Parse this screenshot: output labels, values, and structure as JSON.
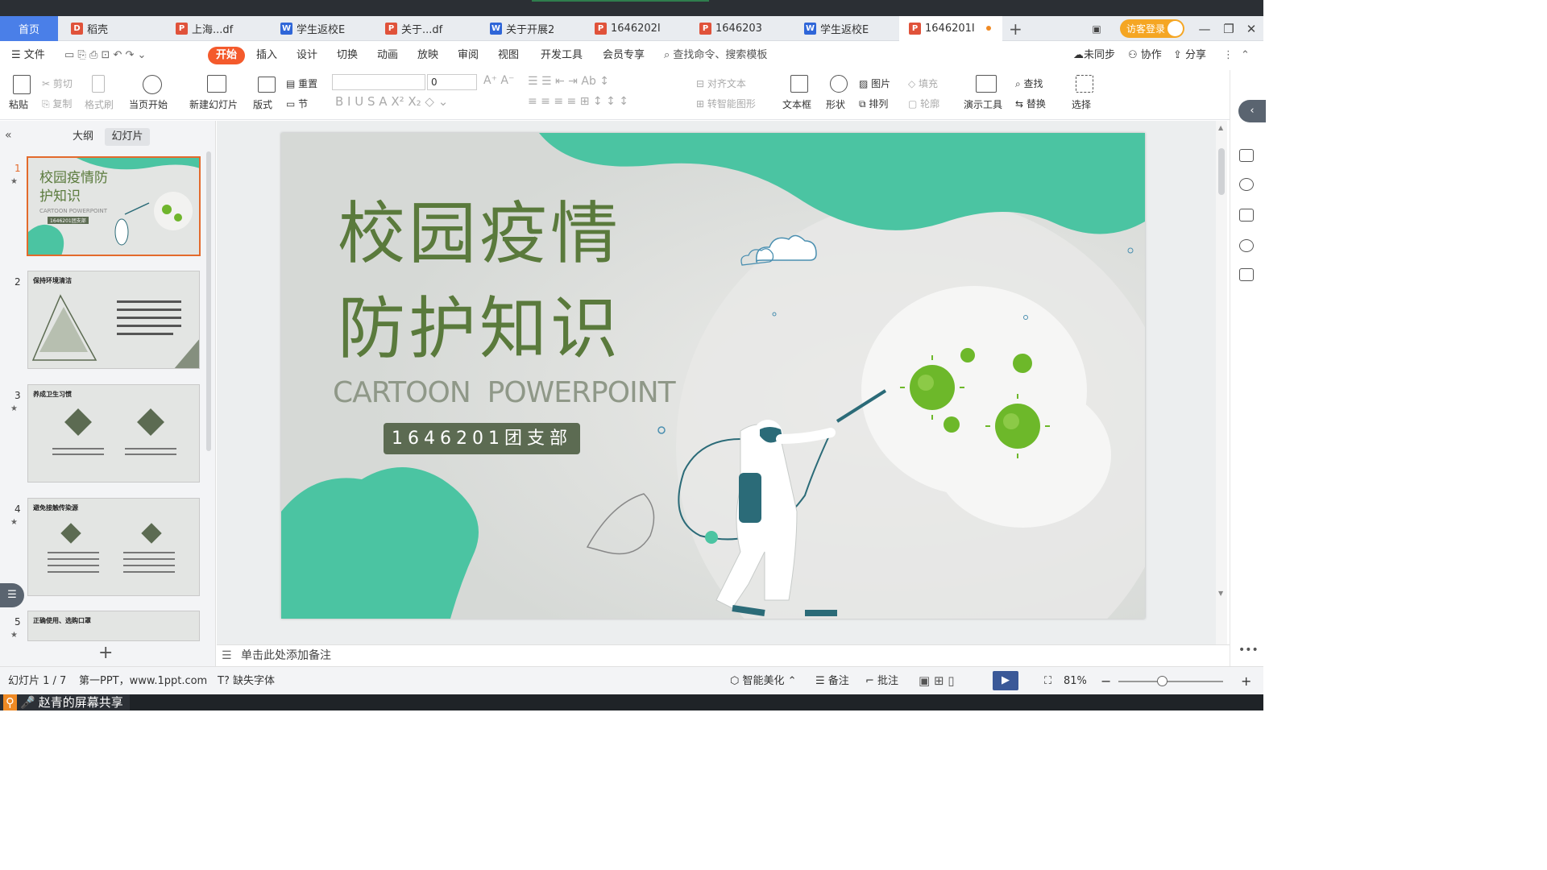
{
  "tabs": [
    {
      "label": "首页",
      "type": "home"
    },
    {
      "label": "稻壳",
      "type": "docer"
    },
    {
      "label": "上海...df",
      "type": "pdf"
    },
    {
      "label": "学生返校E",
      "type": "word"
    },
    {
      "label": "关于...df",
      "type": "pdf"
    },
    {
      "label": "关于开展2",
      "type": "word"
    },
    {
      "label": "1646202I",
      "type": "ppt"
    },
    {
      "label": "1646203",
      "type": "ppt"
    },
    {
      "label": "学生返校E",
      "type": "word"
    },
    {
      "label": "1646201I",
      "type": "ppt",
      "active": true
    }
  ],
  "visitor_login": "访客登录",
  "menu": {
    "file": "文件",
    "items": [
      "开始",
      "插入",
      "设计",
      "切换",
      "动画",
      "放映",
      "审阅",
      "视图",
      "开发工具",
      "会员专享"
    ],
    "search": "查找命令、搜索模板",
    "sync": "未同步",
    "collab": "协作",
    "share": "分享"
  },
  "ribbon": {
    "paste": "粘贴",
    "cut": "剪切",
    "copy": "复制",
    "format_painter": "格式刷",
    "from_current": "当页开始",
    "new_slide": "新建幻灯片",
    "layout": "版式",
    "reset": "重置",
    "section": "节",
    "font_size": "0",
    "align_text": "对齐文本",
    "smart_shape": "转智能图形",
    "textbox": "文本框",
    "shape": "形状",
    "picture": "图片",
    "arrange": "排列",
    "fill": "填充",
    "outline": "轮廓",
    "presenter_tools": "演示工具",
    "find": "查找",
    "replace": "替换",
    "select": "选择"
  },
  "panel": {
    "outline_tab": "大纲",
    "slides_tab": "幻灯片"
  },
  "thumbnails": [
    {
      "num": "1",
      "title": "校园疫情防护知识",
      "sub": "CARTOON POWERPOINT",
      "tag": "1646201团支部"
    },
    {
      "num": "2",
      "title": "保持环境清洁"
    },
    {
      "num": "3",
      "title": "养成卫生习惯"
    },
    {
      "num": "4",
      "title": "避免接触传染源"
    },
    {
      "num": "5",
      "title": "正确使用、选购口罩"
    }
  ],
  "slide": {
    "title_line1": "校园疫情",
    "title_line2": "防护知识",
    "subtitle": "CARTOON  POWERPOINT",
    "badge": "1646201团支部"
  },
  "notes_placeholder": "单击此处添加备注",
  "status": {
    "slide_counter": "幻灯片 1 / 7",
    "theme": "第一PPT，www.1ppt.com",
    "missing_font": "缺失字体",
    "smart_beautify": "智能美化",
    "notes": "备注",
    "comments": "批注",
    "zoom": "81%"
  },
  "screen_share": "赵青的屏幕共享",
  "colors": {
    "accent_orange": "#f45a2c",
    "home_tab_blue": "#4a7fe8",
    "slide_green": "#4bc4a2",
    "title_green": "#5a7a3c",
    "badge_bg": "#5c6b52"
  }
}
